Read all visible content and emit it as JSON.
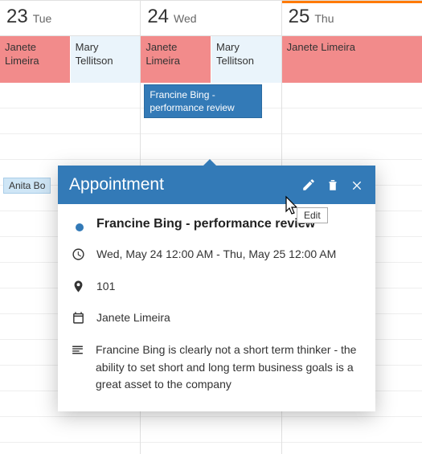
{
  "days": [
    {
      "num": "23",
      "name": "Tue",
      "selected": false,
      "allDay": [
        {
          "text": "Janete Limeira",
          "cls": "pink"
        },
        {
          "text": "Mary Tellitson",
          "cls": "blue-lt"
        }
      ]
    },
    {
      "num": "24",
      "name": "Wed",
      "selected": false,
      "allDay": [
        {
          "text": "Janete Limeira",
          "cls": "pink"
        },
        {
          "text": "Mary Tellitson",
          "cls": "blue-lt"
        }
      ],
      "event": "Francine Bing - performance review"
    },
    {
      "num": "25",
      "name": "Thu",
      "selected": true,
      "allDay": [
        {
          "text": "Janete Limeira",
          "cls": "pink"
        }
      ]
    }
  ],
  "anita": "Anita Bo",
  "popup": {
    "title": "Appointment",
    "subject": "Francine Bing - performance review",
    "time": "Wed, May 24 12:00 AM - Thu, May 25 12:00 AM",
    "location": "101",
    "organizer": "Janete Limeira",
    "notes": "Francine Bing is clearly not a short term thinker - the ability to set short and long term business goals is a great asset to the company",
    "editTooltip": "Edit"
  }
}
